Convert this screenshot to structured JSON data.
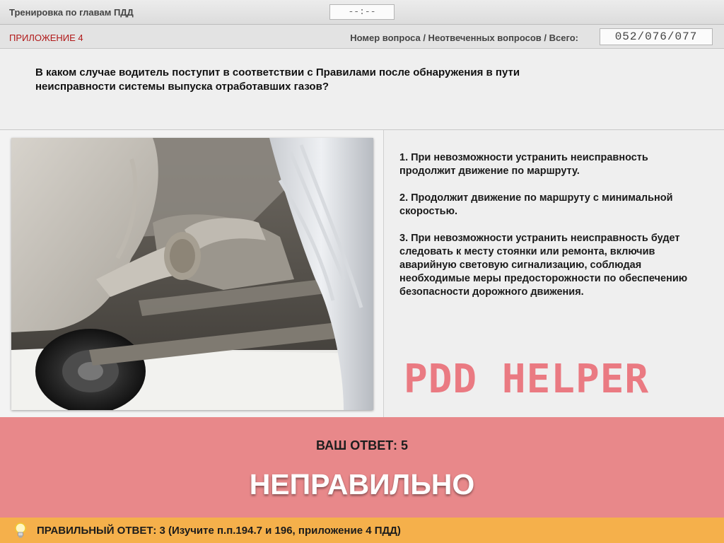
{
  "header": {
    "app_title": "Тренировка по главам ПДД",
    "timer": "--:--"
  },
  "info": {
    "section": "ПРИЛОЖЕНИЕ 4",
    "counter_label": "Номер вопроса / Неотвеченных вопросов / Всего:",
    "counter_value": "052/076/077"
  },
  "question": {
    "text": "В каком случае водитель поступит в соответствии с Правилами после обнаружения в пути неисправности системы выпуска отработавших газов?"
  },
  "answers": [
    {
      "label": "1.  При невозможности устранить неисправность продолжит движение по маршруту."
    },
    {
      "label": "2.  Продолжит движение по маршруту с минимальной скоростью."
    },
    {
      "label": "3.  При невозможности устранить неисправность будет следовать к месту стоянки или ремонта, включив аварийную световую сигнализацию, соблюдая необходимые меры предосторожности по обеспечению безопасности дорожного движения."
    }
  ],
  "watermark": "PDD HELPER",
  "result": {
    "your_answer": "ВАШ  ОТВЕТ:   5",
    "verdict": "НЕПРАВИЛЬНО",
    "color": "#e8888a"
  },
  "hint": {
    "icon": "lightbulb-icon",
    "text": "ПРАВИЛЬНЫЙ ОТВЕТ:   3   (Изучите п.п.194.7 и 196, приложение 4 ПДД)",
    "color": "#f5b04b"
  }
}
